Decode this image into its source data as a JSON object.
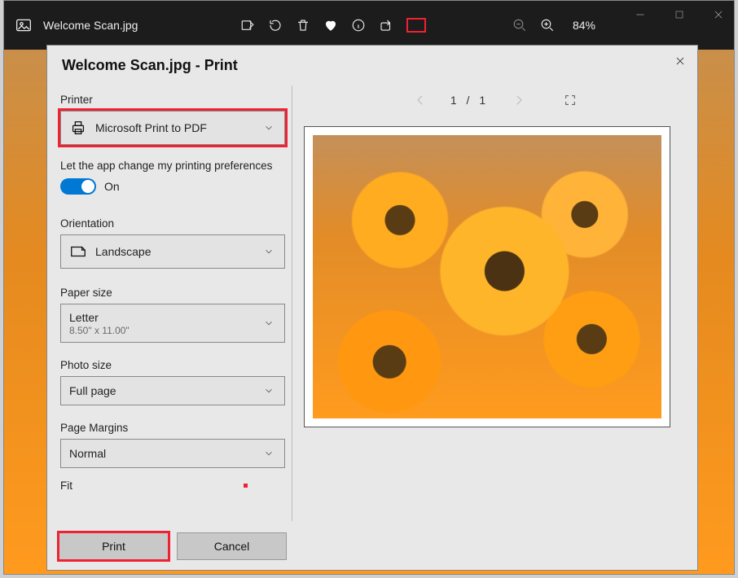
{
  "titlebar": {
    "file_name": "Welcome Scan.jpg",
    "zoom_value": "84%"
  },
  "dialog": {
    "title": "Welcome Scan.jpg - Print",
    "printer_label": "Printer",
    "printer_value": "Microsoft Print to PDF",
    "pref_text": "Let the app change my printing preferences",
    "toggle_state": "On",
    "orientation_label": "Orientation",
    "orientation_value": "Landscape",
    "paper_label": "Paper size",
    "paper_value": "Letter",
    "paper_sub": "8.50\" x 11.00\"",
    "photo_label": "Photo size",
    "photo_value": "Full page",
    "margins_label": "Page Margins",
    "margins_value": "Normal",
    "fit_label": "Fit",
    "print_btn": "Print",
    "cancel_btn": "Cancel"
  },
  "preview": {
    "page_indicator": "1 / 1"
  }
}
